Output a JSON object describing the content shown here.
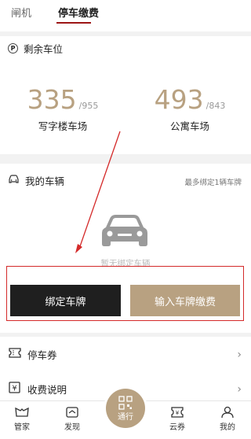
{
  "tabs": [
    {
      "label": "闸机"
    },
    {
      "label": "停车缴费"
    }
  ],
  "availability": {
    "title": "剩余车位",
    "lots": [
      {
        "count": "335",
        "total": "/955",
        "name": "写字楼车场"
      },
      {
        "count": "493",
        "total": "/843",
        "name": "公寓车场"
      }
    ]
  },
  "my_vehicles": {
    "title": "我的车辆",
    "limit_hint": "最多绑定1辆车牌",
    "empty_text": "暂无绑定车辆",
    "bind_button": "绑定车牌",
    "enter_plate_button": "输入车牌缴费"
  },
  "list": [
    {
      "label": "停车券",
      "icon": "ticket-icon"
    },
    {
      "label": "收费说明",
      "icon": "yuan-doc-icon"
    }
  ],
  "bottom_nav": {
    "items": [
      {
        "label": "管家",
        "icon": "butler-icon"
      },
      {
        "label": "发现",
        "icon": "discover-icon"
      },
      {
        "label": "云券",
        "icon": "coupon-icon"
      },
      {
        "label": "我的",
        "icon": "user-icon"
      }
    ],
    "center_label": "通行",
    "center_icon": "qr-code-icon"
  },
  "colors": {
    "accent_gold": "#b8a181",
    "dark_button": "#1f1f1f",
    "tab_underline": "#9d1616",
    "annotation_red": "#d42a2a"
  }
}
